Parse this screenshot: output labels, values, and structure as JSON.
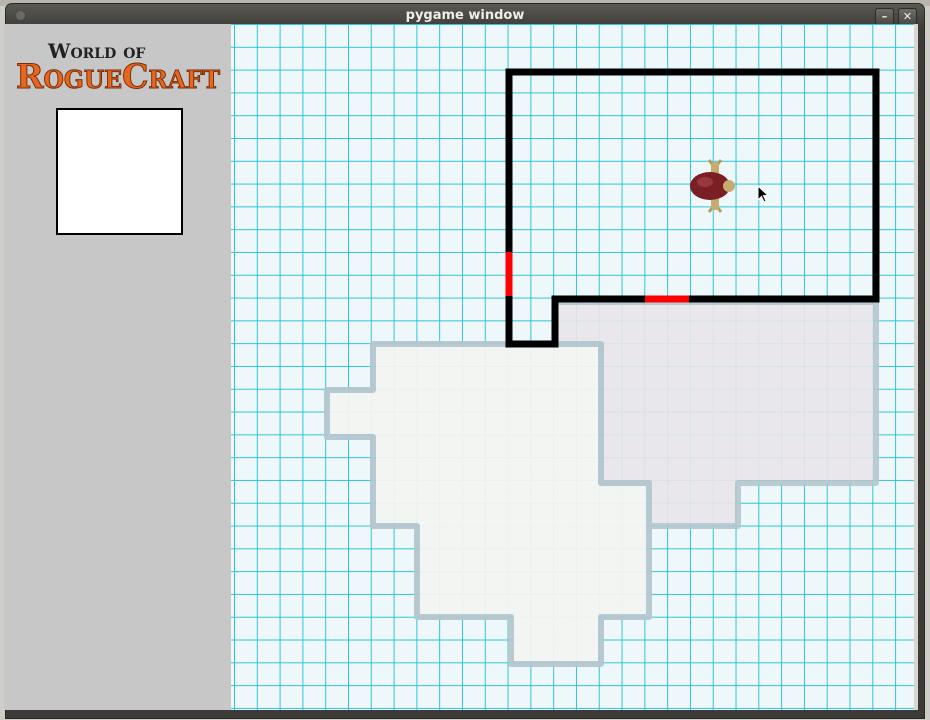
{
  "window": {
    "title": "pygame window",
    "minimize_glyph": "–",
    "close_glyph": "✕"
  },
  "sidebar": {
    "logo": {
      "line1": "World of",
      "line2": "RogueCraft"
    },
    "preview_box": ""
  },
  "map": {
    "grid_color": "#2ec4d6",
    "wall_color": "#000000",
    "door_color": "#ff0000",
    "explored_fill": "#f3f5f2",
    "explored_alt_fill": "#e9e6ea",
    "explored_outline": "#b5c7cf",
    "player_icon": "beetle-character",
    "cursor_icon": "mouse-pointer"
  }
}
